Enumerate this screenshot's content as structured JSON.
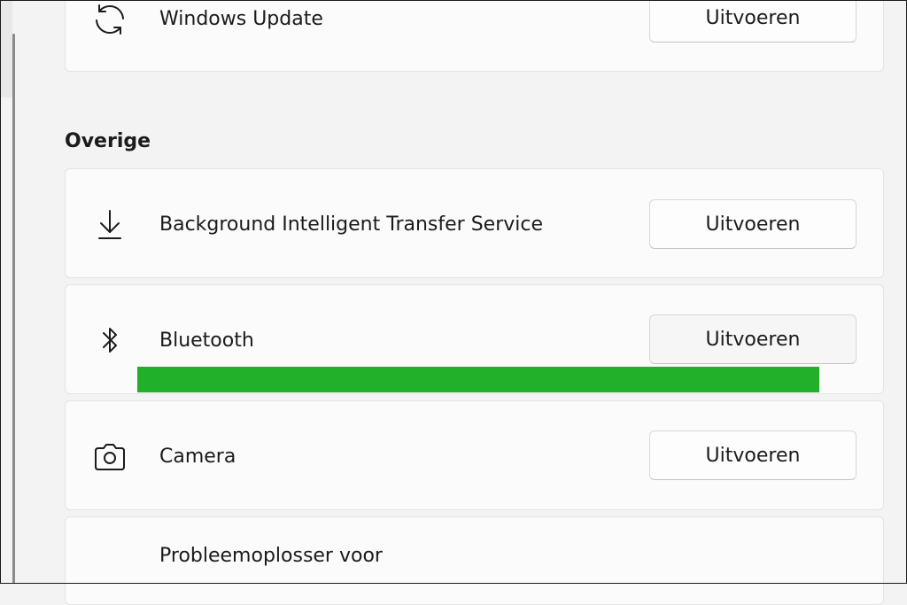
{
  "rows": {
    "windows_update": {
      "label": "Windows Update",
      "button": "Uitvoeren",
      "icon": "refresh-icon"
    },
    "bits": {
      "label": "Background Intelligent Transfer Service",
      "button": "Uitvoeren",
      "icon": "download-icon"
    },
    "bluetooth": {
      "label": "Bluetooth",
      "button": "Uitvoeren",
      "icon": "bluetooth-icon",
      "progress_percent": 100,
      "progress_color": "#22b02b"
    },
    "camera": {
      "label": "Camera",
      "button": "Uitvoeren",
      "icon": "camera-icon"
    },
    "compat": {
      "label": "Probleemoplosser voor"
    }
  },
  "section": {
    "title": "Overige"
  },
  "colors": {
    "background": "#f3f3f3",
    "card": "#fbfbfb",
    "accent_green": "#22b02b"
  }
}
